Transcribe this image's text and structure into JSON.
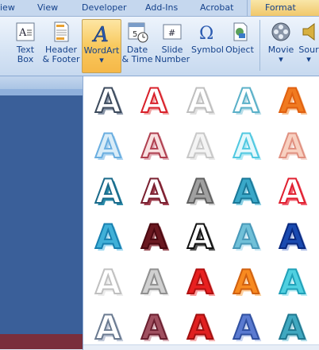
{
  "tabs": [
    "iew",
    "View",
    "Developer",
    "Add-Ins",
    "Acrobat",
    "Format"
  ],
  "ribbon": {
    "buttons": [
      {
        "id": "text-box",
        "line1": "Text",
        "line2": "Box"
      },
      {
        "id": "header-footer",
        "line1": "Header",
        "line2": "& Footer"
      },
      {
        "id": "wordart",
        "line1": "WordArt",
        "line2": "▾"
      },
      {
        "id": "date-time",
        "line1": "Date",
        "line2": "& Time"
      },
      {
        "id": "slide-number",
        "line1": "Slide",
        "line2": "Number"
      },
      {
        "id": "symbol",
        "line1": "Symbol",
        "line2": ""
      },
      {
        "id": "object",
        "line1": "Object",
        "line2": ""
      },
      {
        "id": "movie",
        "line1": "Movie",
        "line2": "▾"
      },
      {
        "id": "sound",
        "line1": "Sour",
        "line2": "▾"
      }
    ]
  },
  "wordart_gallery": {
    "letter": "A",
    "styles": [
      {
        "fill": "#ffffff",
        "stroke": "#3c4a5c",
        "shadow": "#8a96a8"
      },
      {
        "fill": "#ffffff",
        "stroke": "#d8202a",
        "shadow": "#f0a0a0"
      },
      {
        "fill": "#ffffff",
        "stroke": "#bfbfbf",
        "shadow": "#e0e0e0"
      },
      {
        "fill": "#ffffff",
        "stroke": "#5ab0c8",
        "shadow": "#b8dde8"
      },
      {
        "fill": "#f07a20",
        "stroke": "#e06010",
        "shadow": "#f8c090"
      },
      {
        "fill": "#d8ecf8",
        "stroke": "#6aaee0",
        "shadow": "#aed4f0"
      },
      {
        "fill": "#f8e0e0",
        "stroke": "#b04050",
        "shadow": "#e0b0b8"
      },
      {
        "fill": "#f4f4f4",
        "stroke": "#c8c8c8",
        "shadow": "#e8e8e8"
      },
      {
        "fill": "#e4f8fc",
        "stroke": "#50c8e0",
        "shadow": "#b0e8f4"
      },
      {
        "fill": "#f8d0c0",
        "stroke": "#e09080",
        "shadow": "#f4d8d0"
      },
      {
        "fill": "#ffffff",
        "stroke": "#1a6a8a",
        "shadow": "#2a8aa8"
      },
      {
        "fill": "#ffffff",
        "stroke": "#7a2030",
        "shadow": "#a04050"
      },
      {
        "fill": "#a0a0a0",
        "stroke": "#606060",
        "shadow": "#d0d0d0"
      },
      {
        "fill": "#3aa8c8",
        "stroke": "#1a7898",
        "shadow": "#8ad0e4"
      },
      {
        "fill": "#ffffff",
        "stroke": "#e02030",
        "shadow": "#f06070"
      },
      {
        "fill": "#40b0d8",
        "stroke": "#1880b0",
        "shadow": "#a0d8f0"
      },
      {
        "fill": "#6a1820",
        "stroke": "#4a0810",
        "shadow": "#9a5058"
      },
      {
        "fill": "#ffffff",
        "stroke": "#111111",
        "shadow": "#555555"
      },
      {
        "fill": "#70c0d8",
        "stroke": "#4898b8",
        "shadow": "#c8e8f4"
      },
      {
        "fill": "#1a4ab0",
        "stroke": "#0a2a80",
        "shadow": "#b0c0e8"
      },
      {
        "fill": "#ffffff",
        "stroke": "#c0c0c0",
        "shadow": "#ececec"
      },
      {
        "fill": "#d0d0d0",
        "stroke": "#909090",
        "shadow": "#eeeeee"
      },
      {
        "fill": "#e82020",
        "stroke": "#b01010",
        "shadow": "#f8a0a0"
      },
      {
        "fill": "#f88a20",
        "stroke": "#d06010",
        "shadow": "#fcd0a0"
      },
      {
        "fill": "#50d0e0",
        "stroke": "#20a0b8",
        "shadow": "#b8ecf4"
      },
      {
        "fill": "#ffffff",
        "stroke": "#6a7a90",
        "shadow": "#c0c8d8"
      },
      {
        "fill": "#a05060",
        "stroke": "#6a2030",
        "shadow": "#d8b0b8"
      },
      {
        "fill": "#e02020",
        "stroke": "#a01010",
        "shadow": "#f4b0b0"
      },
      {
        "fill": "#5a7ad0",
        "stroke": "#3050a0",
        "shadow": "#c8d4f0"
      },
      {
        "fill": "#40a8c0",
        "stroke": "#207890",
        "shadow": "#b0dce8"
      }
    ]
  },
  "colors": {
    "accent_selected": "#f8c95e",
    "ribbon_text": "#15428b"
  }
}
